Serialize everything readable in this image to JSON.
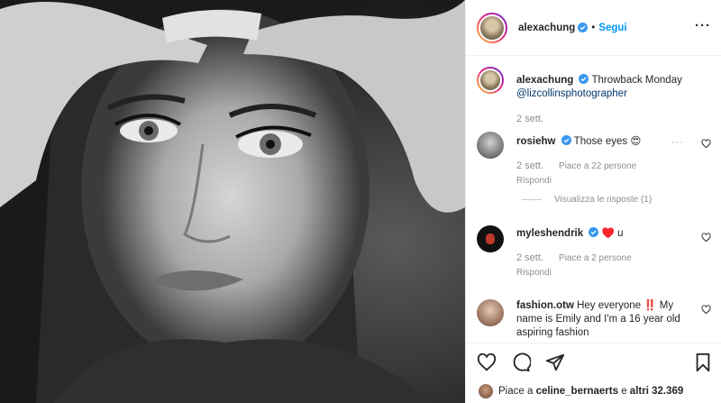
{
  "post": {
    "username": "alexachung",
    "follow_label": "Segui",
    "caption_text": "Throwback Monday",
    "caption_mention": "@lizcollinsphotographer",
    "caption_time": "2 sett."
  },
  "comments": [
    {
      "username": "rosiehw",
      "text": "Those eyes 😍",
      "time": "2 sett.",
      "likes": "Piace a 22 persone",
      "reply": "Rispondi",
      "view_replies": "Visualizza le risposte (1)"
    },
    {
      "username": "myleshendrik",
      "text": "♥️ u",
      "time": "2 sett.",
      "likes": "Piace a 2 persone",
      "reply": "Rispondi"
    },
    {
      "username": "fashion.otw",
      "text": "Hey everyone ‼️ My name is Emily and I'm a 16 year old aspiring fashion"
    }
  ],
  "likes_bar": {
    "prefix": "Piace a",
    "user": "celine_bernaerts",
    "middle": "e",
    "count": "altri 32.369"
  },
  "icons": {
    "more": "more-options-icon",
    "verified": "verified-badge-icon",
    "heart": "heart-icon",
    "comment": "comment-icon",
    "share": "share-icon",
    "save": "bookmark-icon"
  },
  "colors": {
    "accent": "#0095f6",
    "verified": "#3897f0",
    "muted": "#8e8e8e",
    "red_heart": "#e0245e"
  }
}
